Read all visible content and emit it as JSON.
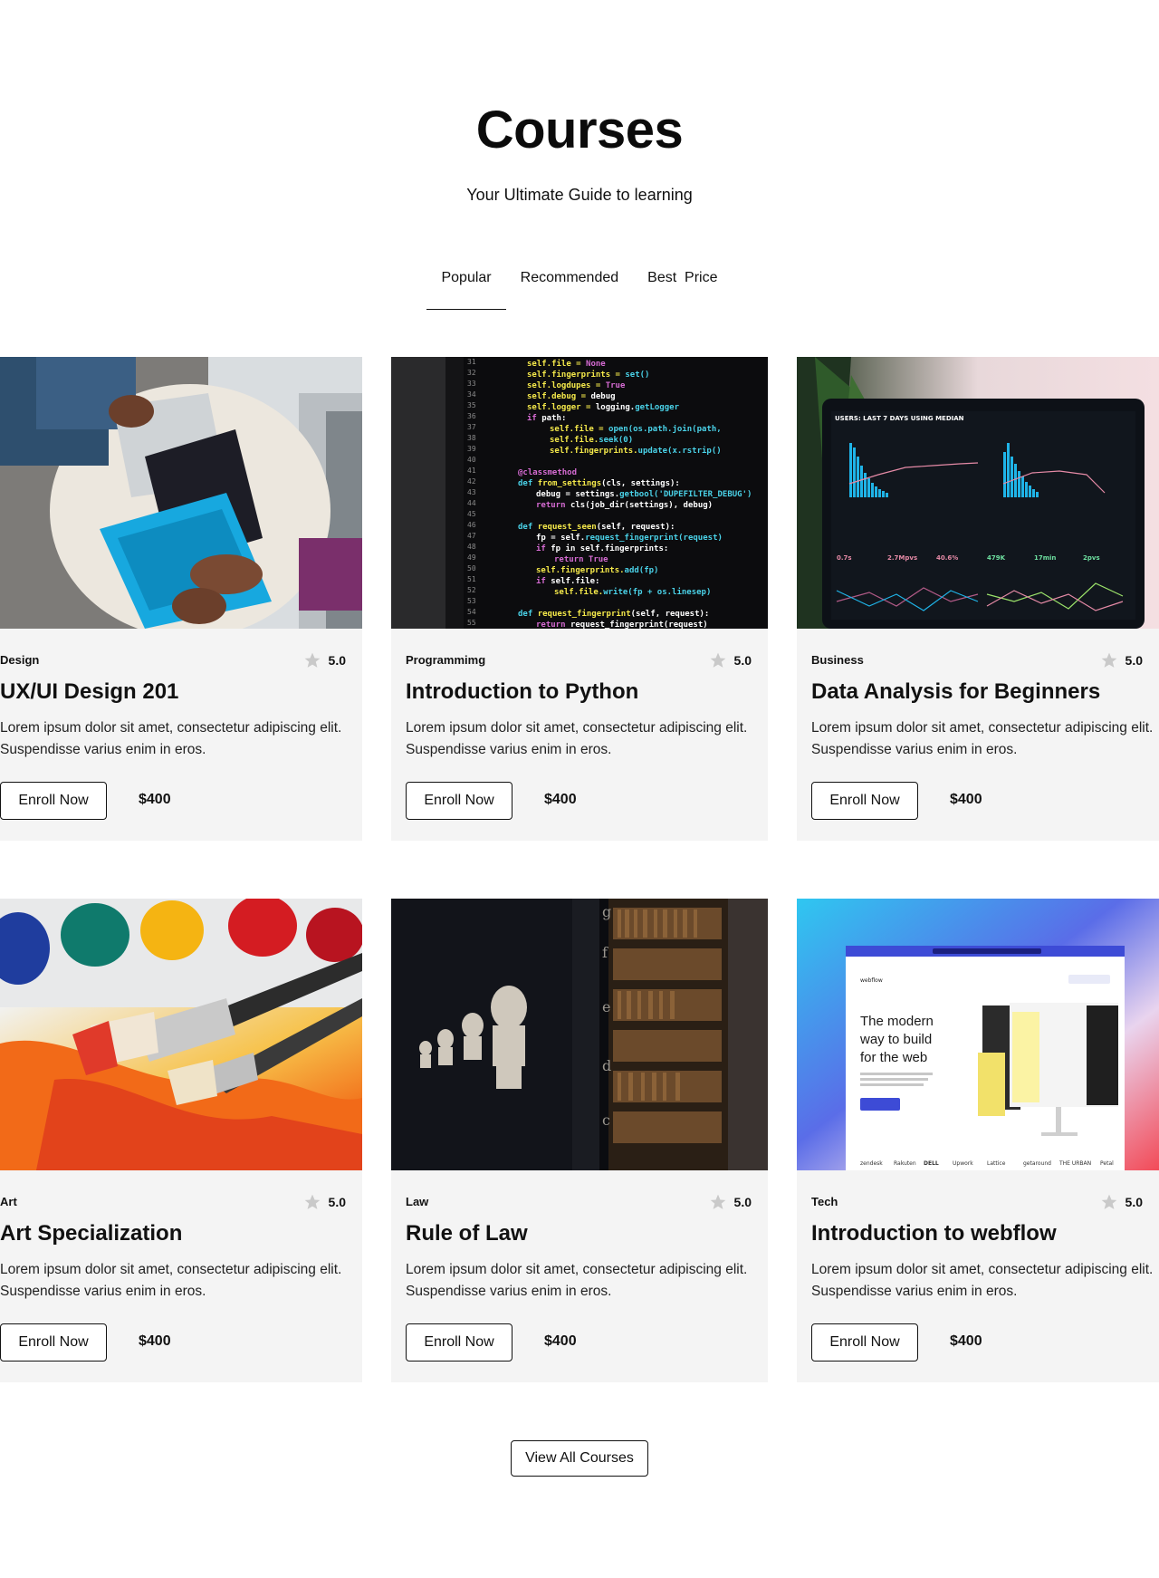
{
  "header": {
    "title": "Courses",
    "subtitle": "Your Ultimate Guide to learning"
  },
  "tabs": [
    {
      "label": "Popular",
      "active": true
    },
    {
      "label": "Recommended",
      "active": false
    },
    {
      "label": "Best  Price",
      "active": false
    }
  ],
  "courses": [
    {
      "category": "Design",
      "rating": "5.0",
      "title": "UX/UI Design 201",
      "description": "Lorem ipsum dolor sit amet, consectetur adipiscing elit. Suspendisse varius enim in eros.",
      "enroll_label": "Enroll Now",
      "price": "$400",
      "image_icon": "laptop-photo"
    },
    {
      "category": "Programmimg",
      "rating": "5.0",
      "title": "Introduction to Python",
      "description": "Lorem ipsum dolor sit amet, consectetur adipiscing elit. Suspendisse varius enim in eros.",
      "enroll_label": "Enroll Now",
      "price": "$400",
      "image_icon": "code-photo"
    },
    {
      "category": "Business",
      "rating": "5.0",
      "title": "Data Analysis for Beginners",
      "description": "Lorem ipsum dolor sit amet, consectetur adipiscing elit. Suspendisse varius enim in eros.",
      "enroll_label": "Enroll Now",
      "price": "$400",
      "image_icon": "dashboard-photo"
    },
    {
      "category": "Art",
      "rating": "5.0",
      "title": "Art Specialization",
      "description": "Lorem ipsum dolor sit amet, consectetur adipiscing elit. Suspendisse varius enim in eros.",
      "enroll_label": "Enroll Now",
      "price": "$400",
      "image_icon": "paintbrush-photo"
    },
    {
      "category": "Law",
      "rating": "5.0",
      "title": "Rule of Law",
      "description": "Lorem ipsum dolor sit amet, consectetur adipiscing elit. Suspendisse varius enim in eros.",
      "enroll_label": "Enroll Now",
      "price": "$400",
      "image_icon": "library-photo"
    },
    {
      "category": "Tech",
      "rating": "5.0",
      "title": "Introduction to webflow",
      "description": "Lorem ipsum dolor sit amet, consectetur adipiscing elit. Suspendisse varius enim in eros.",
      "enroll_label": "Enroll Now",
      "price": "$400",
      "image_icon": "webflow-photo"
    }
  ],
  "webflow_image": {
    "headline": [
      "The modern",
      "way to build",
      "for the web"
    ],
    "logos": [
      "zendesk",
      "Rakuten",
      "DELL",
      "Upwork",
      "Lattice",
      "getaround",
      "THE URBAN",
      "Petal"
    ]
  },
  "footer": {
    "view_all_label": "View All Courses"
  },
  "colors": {
    "card_bg": "#f4f4f4",
    "text": "#111111",
    "star": "#c9c9c9"
  }
}
